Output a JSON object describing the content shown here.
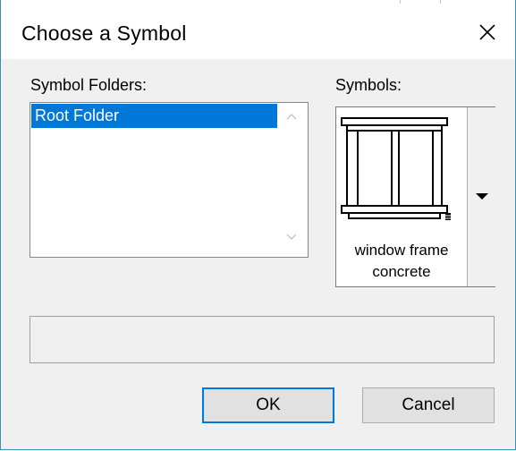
{
  "dialog": {
    "title": "Choose a Symbol",
    "close_icon": "close-icon"
  },
  "folders": {
    "label": "Symbol Folders:",
    "items": [
      {
        "label": "Root Folder",
        "selected": true
      }
    ]
  },
  "symbols": {
    "label": "Symbols:",
    "selected_name": "window frame concrete",
    "preview_icon": "window-frame-icon"
  },
  "buttons": {
    "ok_label": "OK",
    "cancel_label": "Cancel"
  },
  "colors": {
    "selection": "#0078d7",
    "border_accent": "#3c8fb5"
  }
}
